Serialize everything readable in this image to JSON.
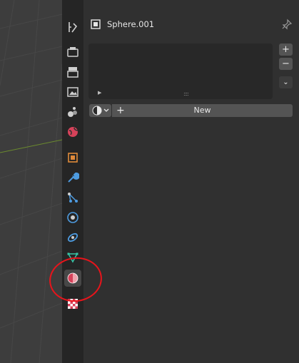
{
  "header": {
    "search_placeholder": ""
  },
  "context": {
    "object_name": "Sphere.001",
    "icon": "object-data-icon",
    "pin_icon": "pin-icon"
  },
  "material_slots": {
    "add_label": "+",
    "remove_label": "−",
    "specials_label": "⌄",
    "expand_label": "▶",
    "grip_label": "::::"
  },
  "material_browse": {
    "icon": "material-browse-icon",
    "new_plus": "+",
    "new_label": "New"
  },
  "tabs": [
    {
      "name": "tool",
      "icon": "tool-icon",
      "active": false
    },
    {
      "name": "render",
      "icon": "render-icon",
      "active": false
    },
    {
      "name": "output",
      "icon": "output-icon",
      "active": false
    },
    {
      "name": "view-layer",
      "icon": "view-layer-icon",
      "active": false
    },
    {
      "name": "scene",
      "icon": "scene-icon",
      "active": false
    },
    {
      "name": "world",
      "icon": "world-icon",
      "active": false
    },
    {
      "name": "object",
      "icon": "object-icon",
      "active": false
    },
    {
      "name": "modifiers",
      "icon": "wrench-icon",
      "active": false
    },
    {
      "name": "particles",
      "icon": "particles-icon",
      "active": false
    },
    {
      "name": "physics",
      "icon": "physics-icon",
      "active": false
    },
    {
      "name": "constraints",
      "icon": "constraints-icon",
      "active": false
    },
    {
      "name": "data",
      "icon": "mesh-data-icon",
      "active": false
    },
    {
      "name": "material",
      "icon": "material-icon",
      "active": true
    },
    {
      "name": "texture",
      "icon": "texture-icon",
      "active": false
    }
  ],
  "colors": {
    "panel_bg": "#303030",
    "tab_bg": "#252525",
    "button": "#545454",
    "annotation_circle": "#e8141b",
    "object_orange": "#e08a3a",
    "world_red": "#d6425a",
    "wrench_blue": "#4d9be0"
  }
}
